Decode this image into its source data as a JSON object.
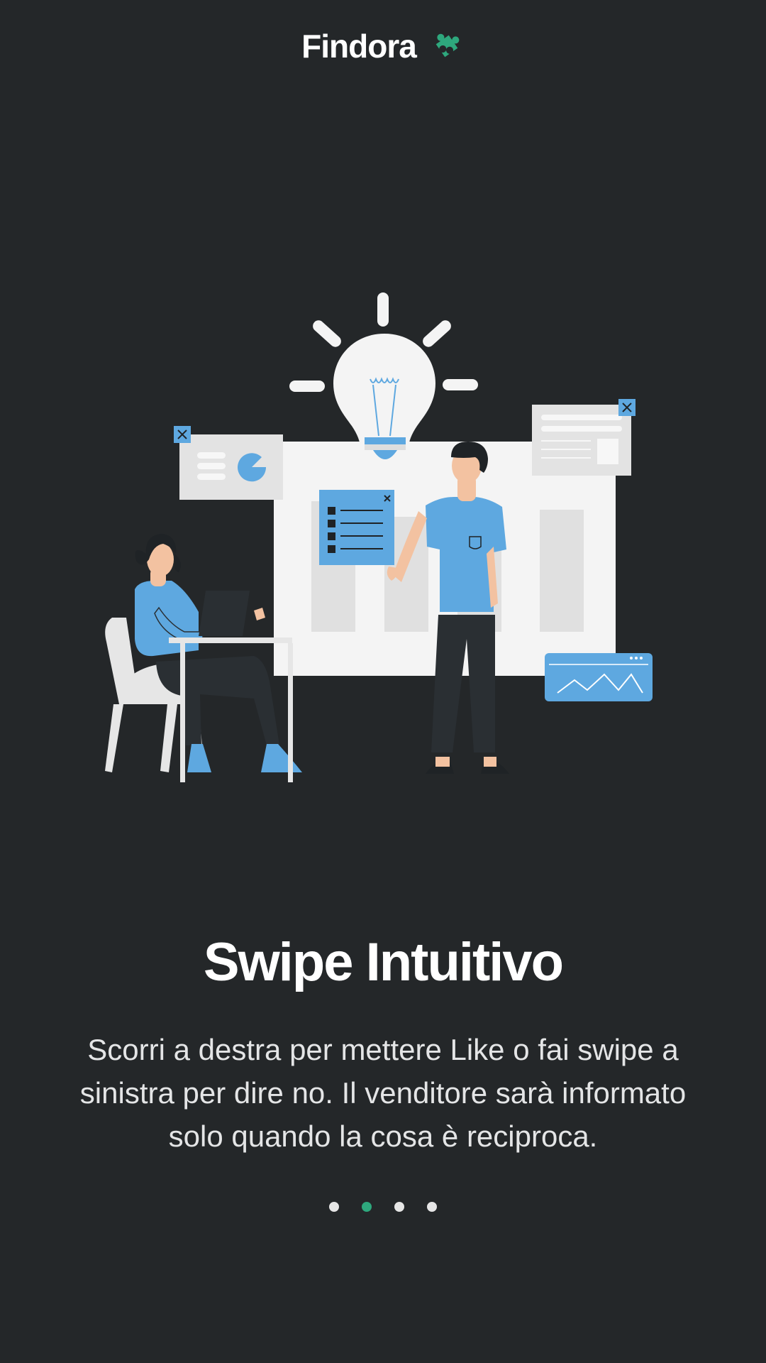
{
  "app": {
    "brand_name": "Findora",
    "brand_icon": "puzzle-icon",
    "accent_color": "#2ea87d",
    "background_color": "#242729"
  },
  "illustration": {
    "subject": "team-ideas-illustration"
  },
  "onboarding": {
    "title": "Swipe Intuitivo",
    "description": "Scorri a destra per mettere Like o fai swipe a sinistra per dire no. Il venditore sarà informato solo quando la cosa è reciproca.",
    "page_indicator": {
      "total": 4,
      "active_index": 1
    }
  }
}
